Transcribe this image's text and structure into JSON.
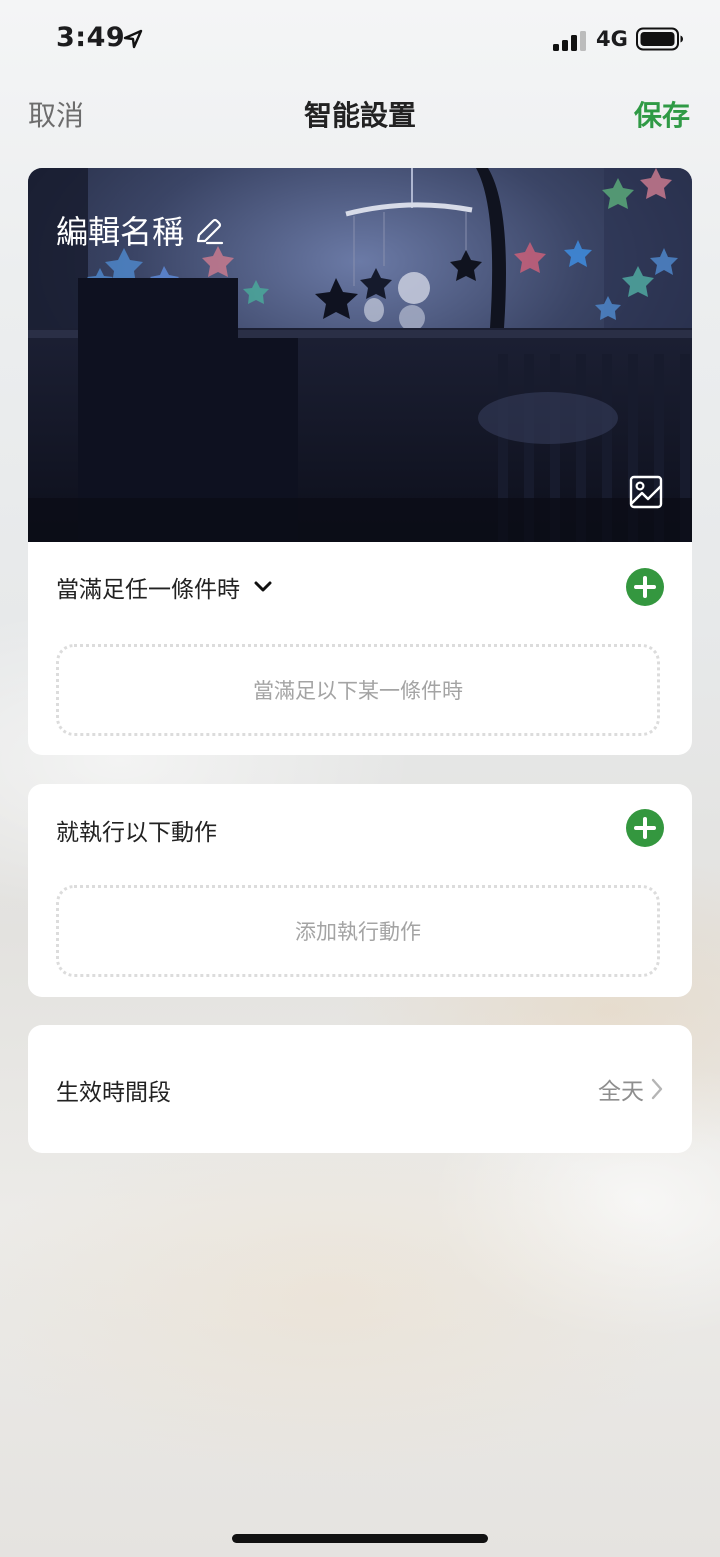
{
  "status_bar": {
    "time": "3:49",
    "network": "4G",
    "icons": [
      "location-arrow-icon",
      "cellular-signal-icon",
      "battery-icon"
    ]
  },
  "nav": {
    "cancel_label": "取消",
    "title": "智能設置",
    "save_label": "保存"
  },
  "scene": {
    "name": "編輯名稱",
    "icons": [
      "edit-pencil-icon",
      "change-image-icon"
    ]
  },
  "conditions": {
    "header": "當滿足任一條件時",
    "placeholder": "當滿足以下某一條件時"
  },
  "actions": {
    "header": "就執行以下動作",
    "placeholder": "添加執行動作"
  },
  "period": {
    "label": "生效時間段",
    "value": "全天"
  },
  "colors": {
    "accent_green": "#2f9a45",
    "add_button_green": "#34973f",
    "nav_cancel_gray": "#6d6d6d",
    "placeholder_gray": "#a4a4a4"
  }
}
